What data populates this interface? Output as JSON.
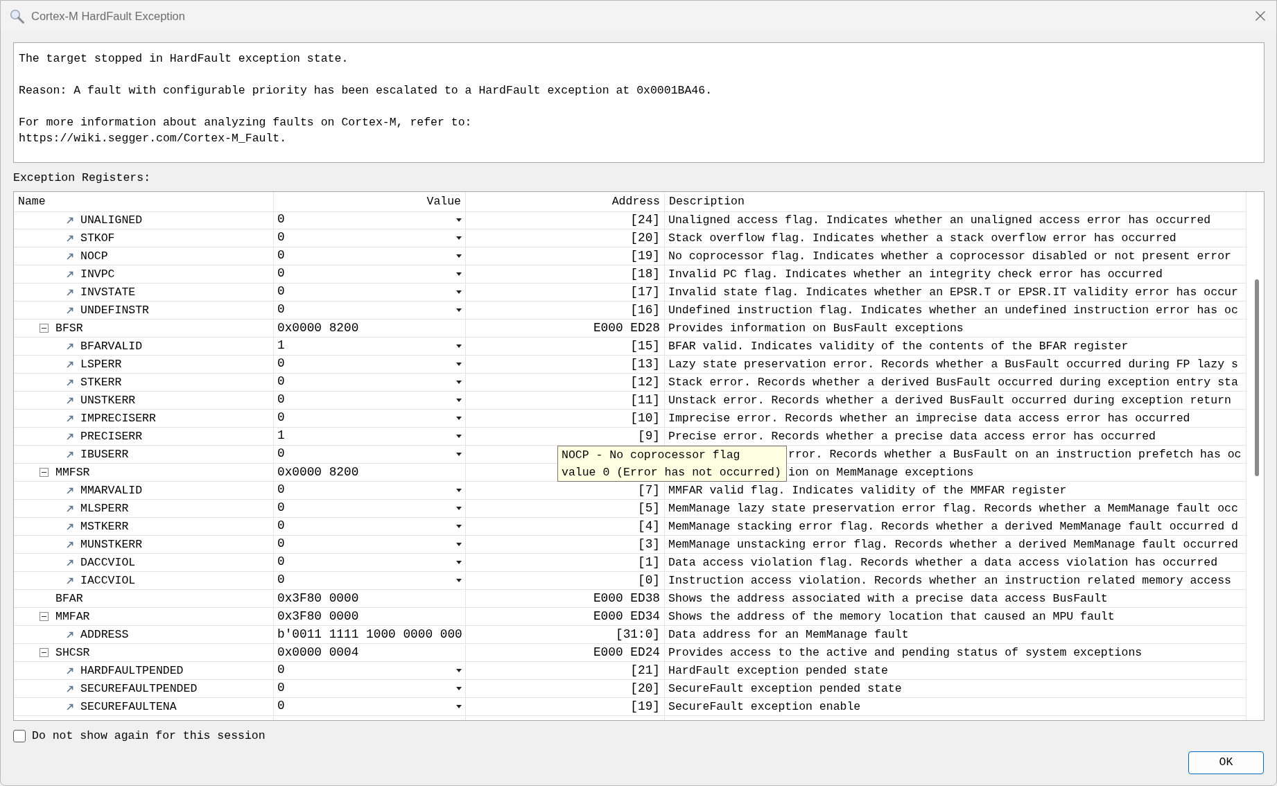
{
  "window": {
    "title": "Cortex-M HardFault Exception"
  },
  "message": {
    "paragraphs": [
      [
        "The target stopped in HardFault exception state."
      ],
      [
        "Reason: A fault with configurable priority has been escalated to a HardFault exception at 0x0001BA46."
      ],
      [
        "For more information about analyzing faults on Cortex-M, refer to:",
        "https://wiki.segger.com/Cortex-M_Fault."
      ]
    ]
  },
  "registers_label": "Exception Registers:",
  "register_table": {
    "columns": [
      "Name",
      "Value",
      "Address",
      "Description"
    ],
    "rows": [
      {
        "kind": "flag",
        "name": "UNALIGNED",
        "value": "0",
        "address": "[24]",
        "description": "Unaligned access flag. Indicates whether an unaligned access error has occurred"
      },
      {
        "kind": "flag",
        "name": "STKOF",
        "value": "0",
        "address": "[20]",
        "description": "Stack overflow flag. Indicates whether a stack overflow error has occurred"
      },
      {
        "kind": "flag",
        "name": "NOCP",
        "value": "0",
        "address": "[19]",
        "description": "No coprocessor flag. Indicates whether a coprocessor disabled or not present error"
      },
      {
        "kind": "flag",
        "name": "INVPC",
        "value": "0",
        "address": "[18]",
        "description": "Invalid PC flag. Indicates whether an integrity check error has occurred"
      },
      {
        "kind": "flag",
        "name": "INVSTATE",
        "value": "0",
        "address": "[17]",
        "description": "Invalid state flag. Indicates whether an EPSR.T or EPSR.IT validity error has occur"
      },
      {
        "kind": "flag",
        "name": "UNDEFINSTR",
        "value": "0",
        "address": "[16]",
        "description": "Undefined instruction flag. Indicates whether an undefined instruction error has oc"
      },
      {
        "kind": "register",
        "name": "BFSR",
        "expanded": true,
        "value": "0x0000 8200",
        "address": "E000 ED28",
        "description": "Provides information on BusFault exceptions",
        "children": [
          {
            "kind": "flag",
            "name": "BFARVALID",
            "value": "1",
            "address": "[15]",
            "description": "BFAR valid. Indicates validity of the contents of the BFAR register"
          },
          {
            "kind": "flag",
            "name": "LSPERR",
            "value": "0",
            "address": "[13]",
            "description": "Lazy state preservation error. Records whether a BusFault occurred during FP lazy s"
          },
          {
            "kind": "flag",
            "name": "STKERR",
            "value": "0",
            "address": "[12]",
            "description": "Stack error. Records whether a derived BusFault occurred during exception entry sta"
          },
          {
            "kind": "flag",
            "name": "UNSTKERR",
            "value": "0",
            "address": "[11]",
            "description": "Unstack error. Records whether a derived BusFault occurred during exception return"
          },
          {
            "kind": "flag",
            "name": "IMPRECISERR",
            "value": "0",
            "address": "[10]",
            "description": "Imprecise error. Records whether an imprecise data access error has occurred"
          },
          {
            "kind": "flag",
            "name": "PRECISERR",
            "value": "1",
            "address": "[9]",
            "description": "Precise error. Records whether a precise data access error has occurred"
          },
          {
            "kind": "flag",
            "name": "IBUSERR",
            "value": "0",
            "description": "rror. Records whether a BusFault on an instruction prefetch has oc"
          }
        ]
      },
      {
        "kind": "register",
        "name": "MMFSR",
        "expanded": true,
        "value": "0x0000 8200",
        "description": "ion on MemManage exceptions",
        "children": [
          {
            "kind": "flag",
            "name": "MMARVALID",
            "value": "0",
            "address": "[7]",
            "description": "MMFAR valid flag. Indicates validity of the MMFAR register"
          },
          {
            "kind": "flag",
            "name": "MLSPERR",
            "value": "0",
            "address": "[5]",
            "description": "MemManage lazy state preservation error flag. Records whether a MemManage fault occ"
          },
          {
            "kind": "flag",
            "name": "MSTKERR",
            "value": "0",
            "address": "[4]",
            "description": "MemManage stacking error flag. Records whether a derived MemManage fault occurred d"
          },
          {
            "kind": "flag",
            "name": "MUNSTKERR",
            "value": "0",
            "address": "[3]",
            "description": "MemManage unstacking error flag. Records whether a derived MemManage fault occurred"
          },
          {
            "kind": "flag",
            "name": "DACCVIOL",
            "value": "0",
            "address": "[1]",
            "description": "Data access violation flag. Records whether a data access violation has occurred"
          },
          {
            "kind": "flag",
            "name": "IACCVIOL",
            "value": "0",
            "address": "[0]",
            "description": "Instruction access violation. Records whether an instruction related memory access"
          }
        ]
      },
      {
        "kind": "register",
        "name": "BFAR",
        "value": "0x3F80 0000",
        "address": "E000 ED38",
        "description": "Shows the address associated with a precise data access BusFault"
      },
      {
        "kind": "register",
        "name": "MMFAR",
        "expanded": true,
        "value": "0x3F80 0000",
        "address": "E000 ED34",
        "description": "Shows the address of the memory location that caused an MPU fault",
        "children": [
          {
            "kind": "field",
            "name": "ADDRESS",
            "value": "b'0011 1111 1000 0000 000",
            "address": "[31:0]",
            "description": "Data address for an MemManage fault"
          }
        ]
      },
      {
        "kind": "register",
        "name": "SHCSR",
        "expanded": true,
        "value": "0x0000 0004",
        "address": "E000 ED24",
        "description": "Provides access to the active and pending status of system exceptions",
        "children": [
          {
            "kind": "flag",
            "name": "HARDFAULTPENDED",
            "value": "0",
            "address": "[21]",
            "description": "HardFault exception pended state"
          },
          {
            "kind": "flag",
            "name": "SECUREFAULTPENDED",
            "value": "0",
            "address": "[20]",
            "description": "SecureFault exception pended state"
          },
          {
            "kind": "flag",
            "name": "SECUREFAULTENA",
            "value": "0",
            "address": "[19]",
            "description": "SecureFault exception enable"
          }
        ]
      }
    ]
  },
  "tooltip": {
    "lines": [
      "NOCP - No coprocessor flag",
      "value 0 (Error has not occurred)"
    ]
  },
  "dont_show_again": {
    "label": "Do not show again for this session",
    "checked": false
  },
  "buttons": [
    {
      "label": "OK"
    }
  ]
}
